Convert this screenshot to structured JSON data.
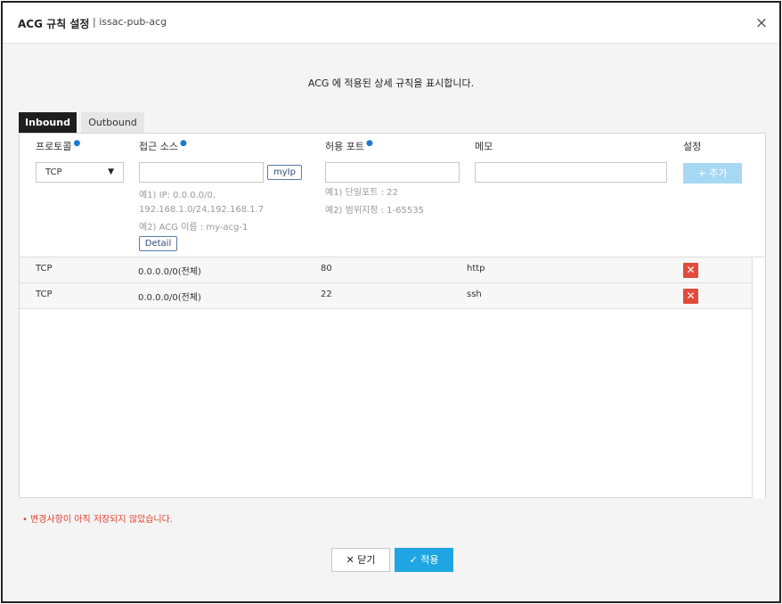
{
  "dialog": {
    "title": "ACG 규칙 설정",
    "subtitle": "| issac-pub-acg",
    "close_glyph": "×"
  },
  "description": "ACG 에 적용된 상세 규칙을 표시합니다.",
  "tabs": [
    {
      "label": "Inbound",
      "active": true
    },
    {
      "label": "Outbound",
      "active": false
    }
  ],
  "columns": {
    "protocol": "프로토콜",
    "source": "접근 소스",
    "port": "허용 포트",
    "memo": "메모",
    "settings": "설정",
    "required_mark": "●"
  },
  "form": {
    "protocol_value": "TCP",
    "protocol_arrow": "▼",
    "source_value": "",
    "myip_label": "myIp",
    "source_hint1": "예1) IP: 0.0.0.0/0,",
    "source_hint1b": "192.168.1.0/24,192.168.1.7",
    "source_hint2": "예2) ACG 이름 : my-acg-1",
    "detail_label": "Detail",
    "port_value": "",
    "port_hint1": "예1) 단일포트 : 22",
    "port_hint2": "예2) 범위지정 : 1-65535",
    "memo_value": "",
    "add_label": "+ 추가"
  },
  "rules": [
    {
      "protocol": "TCP",
      "source": "0.0.0.0/0(전체)",
      "port": "80",
      "memo": "http",
      "delete": "✕"
    },
    {
      "protocol": "TCP",
      "source": "0.0.0.0/0(전체)",
      "port": "22",
      "memo": "ssh",
      "delete": "✕"
    }
  ],
  "warning": "• 변경사항이 아직 저장되지 않았습니다.",
  "footer": {
    "close_label": "✕ 닫기",
    "apply_label": "✓ 적용"
  },
  "colors": {
    "accent": "#1fa5e3",
    "delete": "#e14b3b",
    "warning": "#e2412e",
    "add_disabled": "#a7d8f3"
  }
}
